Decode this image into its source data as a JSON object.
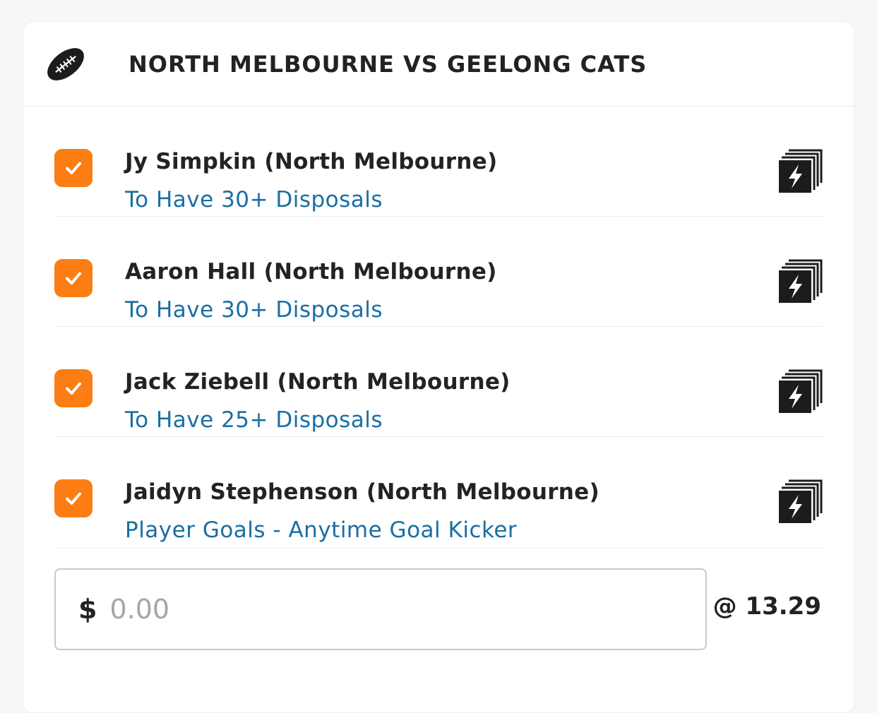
{
  "header": {
    "icon": "football-icon",
    "title": "NORTH MELBOURNE VS GEELONG CATS"
  },
  "legs": [
    {
      "checked": true,
      "player": "Jy Simpkin (North Melbourne)",
      "market": "To Have 30+ Disposals",
      "icon": "same-game-multi-icon"
    },
    {
      "checked": true,
      "player": "Aaron Hall (North Melbourne)",
      "market": "To Have 30+ Disposals",
      "icon": "same-game-multi-icon"
    },
    {
      "checked": true,
      "player": "Jack Ziebell (North Melbourne)",
      "market": "To Have 25+ Disposals",
      "icon": "same-game-multi-icon"
    },
    {
      "checked": true,
      "player": "Jaidyn Stephenson (North Melbourne)",
      "market": "Player Goals - Anytime Goal Kicker",
      "icon": "same-game-multi-icon"
    }
  ],
  "stake": {
    "currency": "$",
    "placeholder": "0.00",
    "value": ""
  },
  "odds": "@ 13.29",
  "colors": {
    "checkbox": "#fb7d14",
    "market_link": "#1a6ea3",
    "title_text": "#222222"
  }
}
